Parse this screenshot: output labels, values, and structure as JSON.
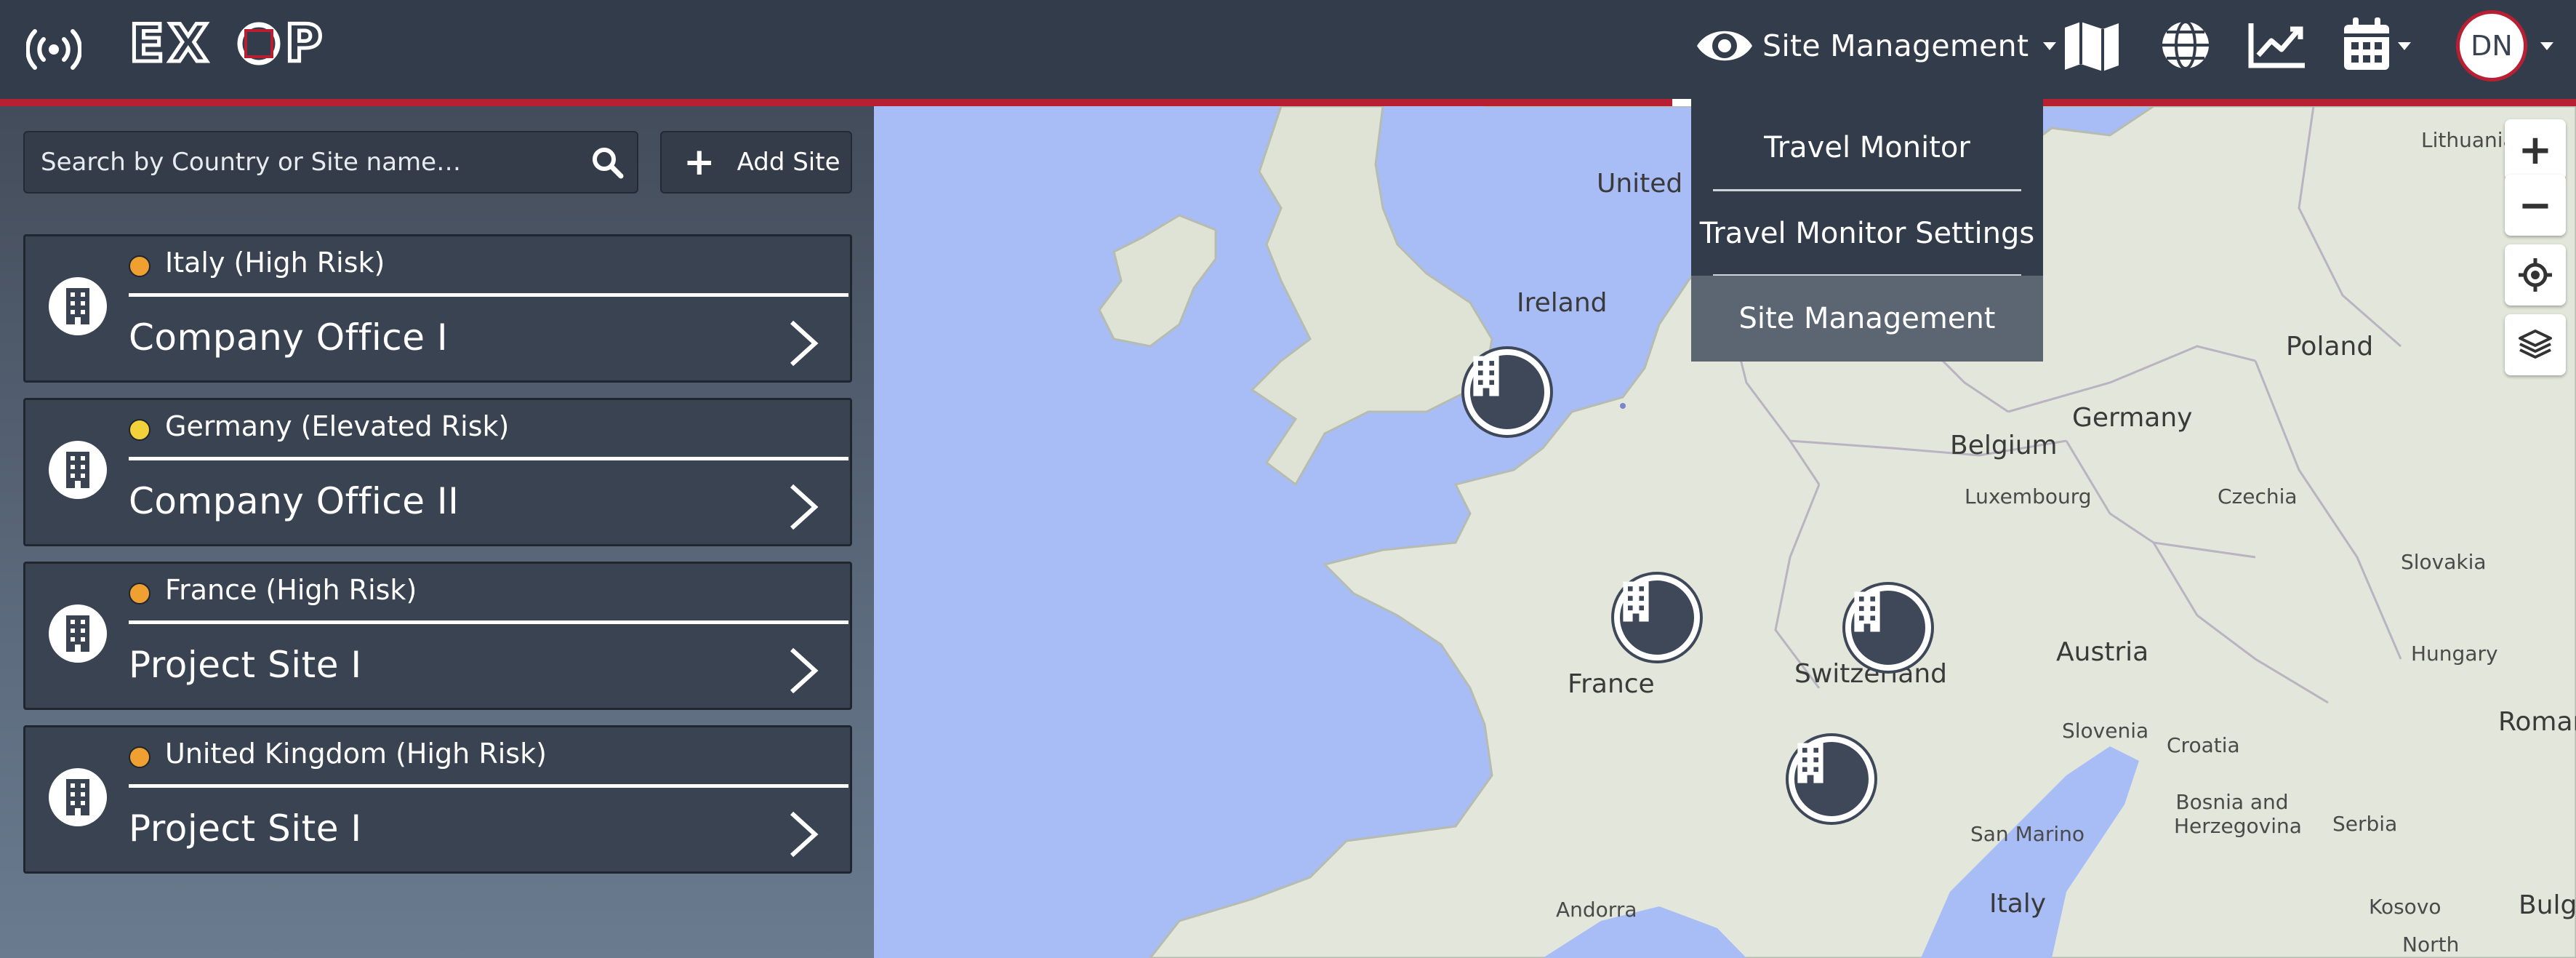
{
  "header": {
    "logo_text": "EXOP",
    "site_management_label": "Site Management",
    "avatar_initials": "DN",
    "accent_color": "#b81f33"
  },
  "dropdown": {
    "items": [
      {
        "label": "Travel Monitor"
      },
      {
        "label": "Travel Monitor Settings"
      },
      {
        "label": "Site Management",
        "active": true
      }
    ]
  },
  "sidebar": {
    "search_placeholder": "Search by Country or Site name…",
    "add_site_label": "Add Site",
    "sites": [
      {
        "risk": "Italy (High Risk)",
        "risk_color": "#f0a030",
        "name": "Company Office I"
      },
      {
        "risk": "Germany (Elevated Risk)",
        "risk_color": "#f2d23a",
        "name": "Company Office II"
      },
      {
        "risk": "France (High Risk)",
        "risk_color": "#f0a030",
        "name": "Project Site I"
      },
      {
        "risk": "United Kingdom (High Risk)",
        "risk_color": "#f0a030",
        "name": "Project Site I"
      }
    ]
  },
  "map": {
    "labels": {
      "uk": "United Kingdom",
      "ireland": "Ireland",
      "belgium": "Belgium",
      "luxembourg": "Luxembourg",
      "germany": "Germany",
      "poland": "Poland",
      "lithuania": "Lithuania",
      "czechia": "Czechia",
      "slovakia": "Slovakia",
      "france": "France",
      "switzerland": "Switzerland",
      "austria": "Austria",
      "hungary": "Hungary",
      "slovenia": "Slovenia",
      "croatia": "Croatia",
      "romania": "Romania",
      "bosnia": "Bosnia and Herzegovina",
      "serbia": "Serbia",
      "san_marino": "San Marino",
      "italy": "Italy",
      "andorra": "Andorra",
      "kosovo": "Kosovo",
      "bulgaria": "Bulgaria",
      "north": "North"
    },
    "zoom_in": "+",
    "zoom_out": "−"
  }
}
